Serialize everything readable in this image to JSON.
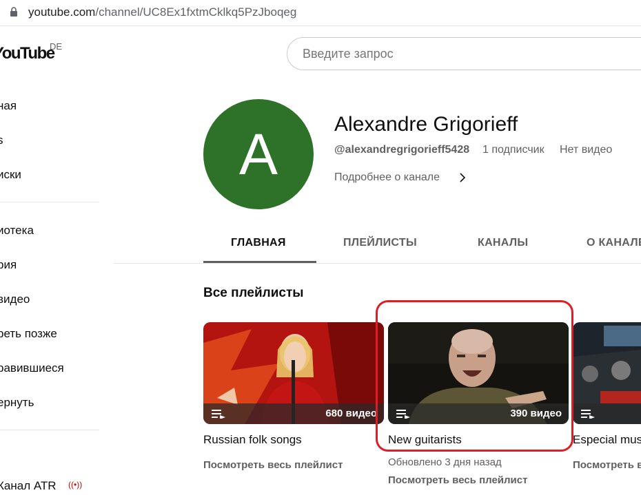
{
  "browser": {
    "url_host": "youtube.com",
    "url_path": "/channel/UC8Ex1fxtmCklkq5PzJboqeg"
  },
  "logo": {
    "text": "YouTube",
    "country": "DE"
  },
  "search": {
    "placeholder": "Введите запрос"
  },
  "sidebar": {
    "items": [
      {
        "label": "ная"
      },
      {
        "label": "s"
      },
      {
        "label": "иски"
      },
      {
        "label": "иотека"
      },
      {
        "label": "рия"
      },
      {
        "label": "видео"
      },
      {
        "label": "реть позже"
      },
      {
        "label": "равившиеся"
      },
      {
        "label": "ернуть"
      },
      {
        "label": "Канал ATR"
      }
    ]
  },
  "channel": {
    "avatar_letter": "A",
    "avatar_color": "#2d7228",
    "name": "Alexandre Grigorieff",
    "handle": "@alexandregrigorieff5428",
    "subscribers": "1 подписчик",
    "videos": "Нет видео",
    "more_link": "Подробнее о канале"
  },
  "tabs": [
    {
      "label": "ГЛАВНАЯ",
      "active": true
    },
    {
      "label": "ПЛЕЙЛИСТЫ",
      "active": false
    },
    {
      "label": "КАНАЛЫ",
      "active": false
    },
    {
      "label": "О КАНАЛЕ",
      "active": false
    }
  ],
  "section": {
    "title": "Все плейлисты"
  },
  "playlists": [
    {
      "title": "Russian folk songs",
      "count": "680 видео",
      "updated": "",
      "link": "Посмотреть весь плейлист"
    },
    {
      "title": "New guitarists",
      "count": "390 видео",
      "updated": "Обновлено 3 дня назад",
      "link": "Посмотреть весь плейлист"
    },
    {
      "title": "Especial music",
      "count": "",
      "updated": "",
      "link": "Посмотреть весь плейлист"
    }
  ],
  "colors": {
    "highlight": "#e01c24",
    "live": "#cc0000"
  }
}
